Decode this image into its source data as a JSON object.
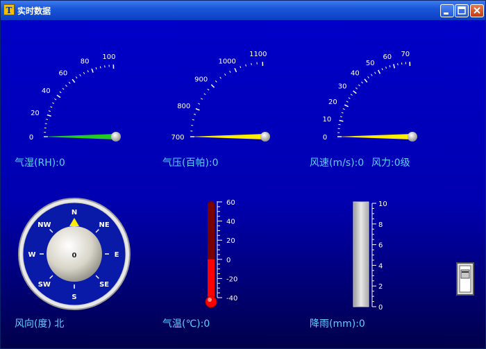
{
  "window": {
    "title": "实时数据",
    "app_icon_glyph": "T",
    "buttons": [
      "minimize-icon",
      "maximize-icon",
      "close-icon"
    ]
  },
  "gauges": {
    "humidity": {
      "label": "气湿(RH):0",
      "ticks": [
        "0",
        "20",
        "40",
        "60",
        "80",
        "100"
      ],
      "value": 0,
      "needle_color": "#22cc22"
    },
    "pressure": {
      "label": "气压(百帕):0",
      "ticks": [
        "700",
        "800",
        "900",
        "1000",
        "1100"
      ],
      "value": 700,
      "needle_color": "#ffee00"
    },
    "wind_speed": {
      "label": "风速(m/s):0",
      "force_label": "风力:0级",
      "ticks": [
        "0",
        "10",
        "20",
        "30",
        "40",
        "50",
        "60",
        "70"
      ],
      "value": 0,
      "needle_color": "#ffee00"
    }
  },
  "compass": {
    "label": "风向(度) 北",
    "center_value": "0",
    "directions": [
      "N",
      "NE",
      "E",
      "SE",
      "S",
      "SW",
      "W",
      "NW"
    ],
    "pointer_color": "#ffee00"
  },
  "thermometer": {
    "label": "气温(℃):0",
    "ticks": [
      "60",
      "40",
      "20",
      "0",
      "-20",
      "-40"
    ],
    "value": 0,
    "fill_color": "#ff0000"
  },
  "rain": {
    "label": "降雨(mm):0",
    "ticks": [
      "10",
      "8",
      "6",
      "4",
      "2",
      "0"
    ],
    "value": 0
  },
  "toggle": {
    "state": "off"
  }
}
